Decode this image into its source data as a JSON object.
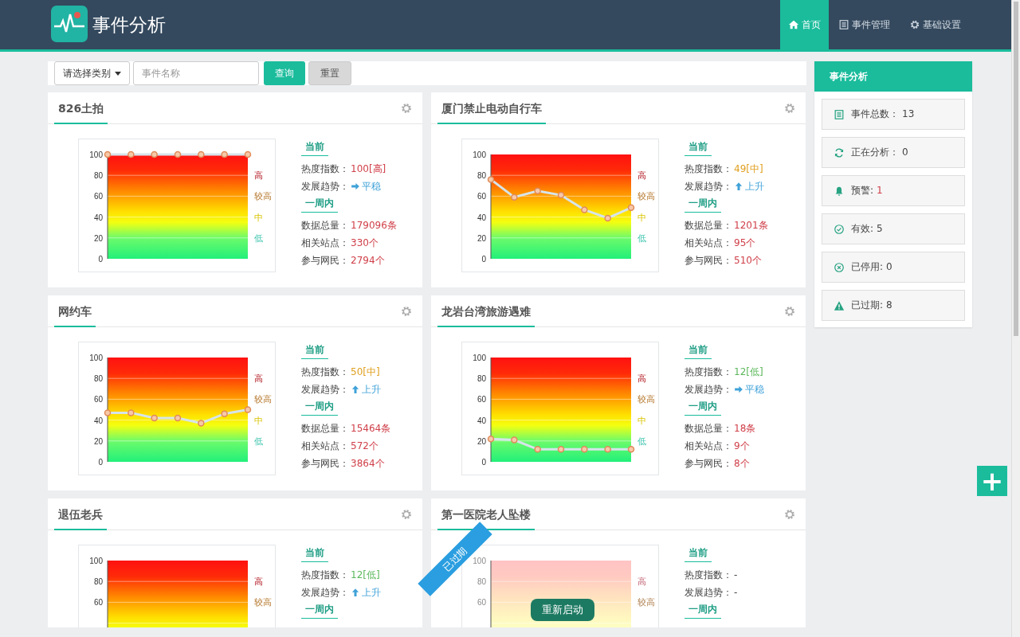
{
  "app": {
    "title": "事件分析"
  },
  "nav": [
    {
      "label": "首页",
      "kind": "home",
      "selected": true
    },
    {
      "label": "事件管理",
      "kind": "list",
      "selected": false
    },
    {
      "label": "基础设置",
      "kind": "gear",
      "selected": false
    }
  ],
  "toolbar": {
    "category": "请选择类别",
    "search": {
      "placeholder": "事件名称"
    },
    "buttons": [
      {
        "label": "查询",
        "kind": "primary"
      },
      {
        "label": "重置",
        "kind": "default"
      }
    ]
  },
  "cards": [
    {
      "title": "826土拍",
      "expired": false,
      "chart_data": {
        "type": "line",
        "ylim": [
          0,
          100
        ],
        "yticks": [
          0,
          20,
          40,
          60,
          80,
          100
        ],
        "grid": true,
        "series": [
          {
            "color": "#d6e4ea",
            "marker": true,
            "values": [
              100,
              100,
              100,
              100,
              100,
              100,
              100
            ]
          }
        ]
      },
      "level_labels": [
        "高",
        "较高",
        "中",
        "低"
      ],
      "current_heading": "当前",
      "heat": {
        "label": "热度指数：",
        "value": "100[高]",
        "kind": "high"
      },
      "trend": {
        "label": "发展趋势：",
        "value": "平稳",
        "kind": "flat"
      },
      "week_heading": "一周内",
      "week_stats": [
        {
          "label": "数据总量：",
          "value": "179096条"
        },
        {
          "label": "相关站点：",
          "value": "330个"
        },
        {
          "label": "参与网民：",
          "value": "2794个"
        }
      ]
    },
    {
      "title": "厦门禁止电动自行车",
      "expired": false,
      "chart_data": {
        "type": "line",
        "ylim": [
          0,
          100
        ],
        "yticks": [
          0,
          20,
          40,
          60,
          80,
          100
        ],
        "grid": true,
        "series": [
          {
            "color": "#d6e4ea",
            "marker": true,
            "values": [
              76,
              59,
              65,
              61,
              47,
              39,
              49
            ]
          }
        ]
      },
      "level_labels": [
        "高",
        "较高",
        "中",
        "低"
      ],
      "current_heading": "当前",
      "heat": {
        "label": "热度指数：",
        "value": "49[中]",
        "kind": "mid"
      },
      "trend": {
        "label": "发展趋势：",
        "value": "上升",
        "kind": "up"
      },
      "week_heading": "一周内",
      "week_stats": [
        {
          "label": "数据总量：",
          "value": "1201条"
        },
        {
          "label": "相关站点：",
          "value": "95个"
        },
        {
          "label": "参与网民：",
          "value": "510个"
        }
      ]
    },
    {
      "title": "网约车",
      "expired": false,
      "chart_data": {
        "type": "line",
        "ylim": [
          0,
          100
        ],
        "yticks": [
          0,
          20,
          40,
          60,
          80,
          100
        ],
        "grid": true,
        "series": [
          {
            "color": "#d6e4ea",
            "marker": true,
            "values": [
              47,
              47,
              42,
              42,
              37,
              46,
              50
            ]
          }
        ]
      },
      "level_labels": [
        "高",
        "较高",
        "中",
        "低"
      ],
      "current_heading": "当前",
      "heat": {
        "label": "热度指数：",
        "value": "50[中]",
        "kind": "mid"
      },
      "trend": {
        "label": "发展趋势：",
        "value": "上升",
        "kind": "up"
      },
      "week_heading": "一周内",
      "week_stats": [
        {
          "label": "数据总量：",
          "value": "15464条"
        },
        {
          "label": "相关站点：",
          "value": "572个"
        },
        {
          "label": "参与网民：",
          "value": "3864个"
        }
      ]
    },
    {
      "title": "龙岩台湾旅游遇难",
      "expired": false,
      "chart_data": {
        "type": "line",
        "ylim": [
          0,
          100
        ],
        "yticks": [
          0,
          20,
          40,
          60,
          80,
          100
        ],
        "grid": true,
        "series": [
          {
            "color": "#d6e4ea",
            "marker": true,
            "values": [
              22,
              21,
              12,
              12,
              12,
              12,
              12
            ]
          }
        ]
      },
      "level_labels": [
        "高",
        "较高",
        "中",
        "低"
      ],
      "current_heading": "当前",
      "heat": {
        "label": "热度指数：",
        "value": "12[低]",
        "kind": "low"
      },
      "trend": {
        "label": "发展趋势：",
        "value": "平稳",
        "kind": "flat"
      },
      "week_heading": "一周内",
      "week_stats": [
        {
          "label": "数据总量：",
          "value": "18条"
        },
        {
          "label": "相关站点：",
          "value": "9个"
        },
        {
          "label": "参与网民：",
          "value": "8个"
        }
      ]
    },
    {
      "title": "退伍老兵",
      "expired": false,
      "y_ticks": [
        "100",
        "80",
        "60"
      ],
      "level_labels": [
        "高",
        "较高"
      ],
      "current_heading": "当前",
      "heat": {
        "label": "热度指数：",
        "value": "12[低]",
        "kind": "low"
      },
      "trend": {
        "label": "发展趋势：",
        "value": "上升",
        "kind": "up"
      },
      "week_heading": "一周内"
    },
    {
      "title": "第一医院老人坠楼",
      "expired": true,
      "ribbon": "已过期",
      "restart": "重新启动",
      "y_ticks": [
        "100",
        "80",
        "60"
      ],
      "level_labels": [
        "高",
        "较高"
      ],
      "current_heading": "当前",
      "heat": {
        "label": "热度指数：",
        "value": "-",
        "kind": "none"
      },
      "trend": {
        "label": "发展趋势：",
        "value": "-",
        "kind": "none"
      },
      "week_heading": "一周内"
    }
  ],
  "panel": {
    "title": "事件分析",
    "items": [
      {
        "kind": "list",
        "label": "事件总数：",
        "value": "13",
        "highlight": false
      },
      {
        "kind": "refresh",
        "label": "正在分析：",
        "value": "0",
        "highlight": false
      },
      {
        "kind": "bell",
        "label": "预警:",
        "value": "1",
        "highlight": true
      },
      {
        "kind": "check",
        "label": "有效:",
        "value": "5",
        "highlight": false
      },
      {
        "kind": "cross",
        "label": "已停用:",
        "value": "0",
        "highlight": false
      },
      {
        "kind": "warning",
        "label": "已过期:",
        "value": "8",
        "highlight": false
      }
    ]
  },
  "fab": {
    "label": "+"
  }
}
